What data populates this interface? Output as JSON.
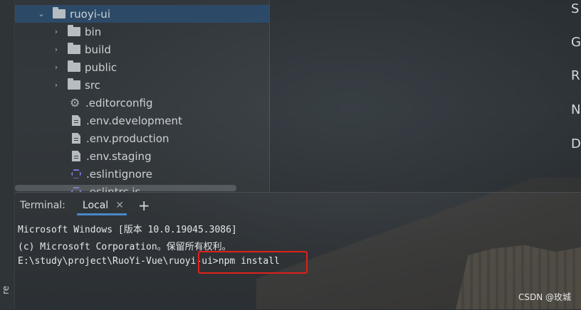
{
  "sidebar": {
    "gutter_label": "re",
    "tree": [
      {
        "label": "ruoyi-ui",
        "type": "folder",
        "expanded": true,
        "level": 0
      },
      {
        "label": "bin",
        "type": "folder",
        "expanded": false,
        "level": 1
      },
      {
        "label": "build",
        "type": "folder",
        "expanded": false,
        "level": 1
      },
      {
        "label": "public",
        "type": "folder",
        "expanded": false,
        "level": 1
      },
      {
        "label": "src",
        "type": "folder",
        "expanded": false,
        "level": 1
      },
      {
        "label": ".editorconfig",
        "type": "config",
        "level": 1
      },
      {
        "label": ".env.development",
        "type": "file",
        "level": 1
      },
      {
        "label": ".env.production",
        "type": "file",
        "level": 1
      },
      {
        "label": ".env.staging",
        "type": "file",
        "level": 1
      },
      {
        "label": ".eslintignore",
        "type": "eslint",
        "level": 1
      },
      {
        "label": ".eslintrc.js",
        "type": "eslint",
        "level": 1
      }
    ]
  },
  "editor": {
    "clipped_letters": [
      "S",
      "G",
      "R",
      "N",
      "D"
    ]
  },
  "terminal": {
    "title": "Terminal:",
    "tab_label": "Local",
    "lines": [
      "Microsoft Windows [版本 10.0.19045.3086]",
      "(c) Microsoft Corporation。保留所有权利。",
      "",
      "E:\\study\\project\\RuoYi-Vue\\ruoyi-ui>npm install"
    ]
  },
  "watermark": "CSDN @玫城",
  "colors": {
    "selection": "#2b4e70",
    "tab_underline": "#4a88c7",
    "highlight_box": "#e0201a",
    "eslint_icon": "#8b7cf2"
  }
}
